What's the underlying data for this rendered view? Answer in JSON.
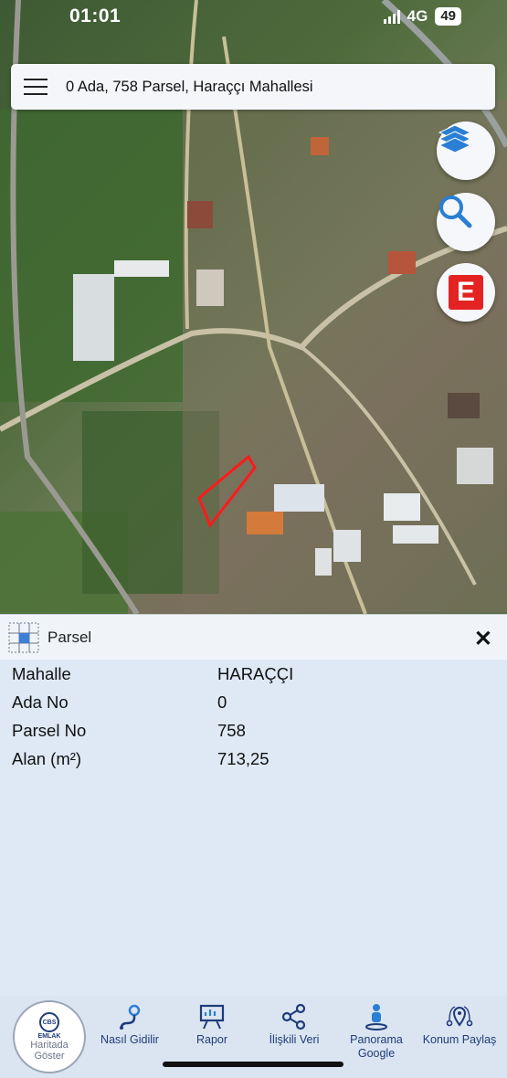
{
  "status": {
    "time": "01:01",
    "network": "4G",
    "battery": "49"
  },
  "search": {
    "text": "0 Ada, 758 Parsel, Haraççı Mahallesi"
  },
  "map_controls": {
    "layers": "layers-icon",
    "search": "search-icon",
    "e_label": "E"
  },
  "panel": {
    "title": "Parsel",
    "close": "✕",
    "rows": [
      {
        "key": "Mahalle",
        "value": "HARAÇÇI"
      },
      {
        "key": "Ada No",
        "value": "0"
      },
      {
        "key": "Parsel No",
        "value": "758"
      },
      {
        "key": "Alan (m²)",
        "value": "713,25"
      }
    ]
  },
  "logo": {
    "emblem": "CBS",
    "brand": "EMLAK",
    "line1": "Haritada",
    "line2": "Göster"
  },
  "nav": [
    {
      "label": "Nasıl Gidilir",
      "icon": "route-icon"
    },
    {
      "label": "Rapor",
      "icon": "report-icon"
    },
    {
      "label": "İlişkili Veri",
      "icon": "share-icon"
    },
    {
      "label": "Panorama Google",
      "icon": "street-view-icon"
    },
    {
      "label": "Konum Paylaş",
      "icon": "location-share-icon"
    }
  ],
  "colors": {
    "accent": "#1f3b7a",
    "highlight": "#e32222",
    "panel_bg": "#dfe9f5"
  }
}
